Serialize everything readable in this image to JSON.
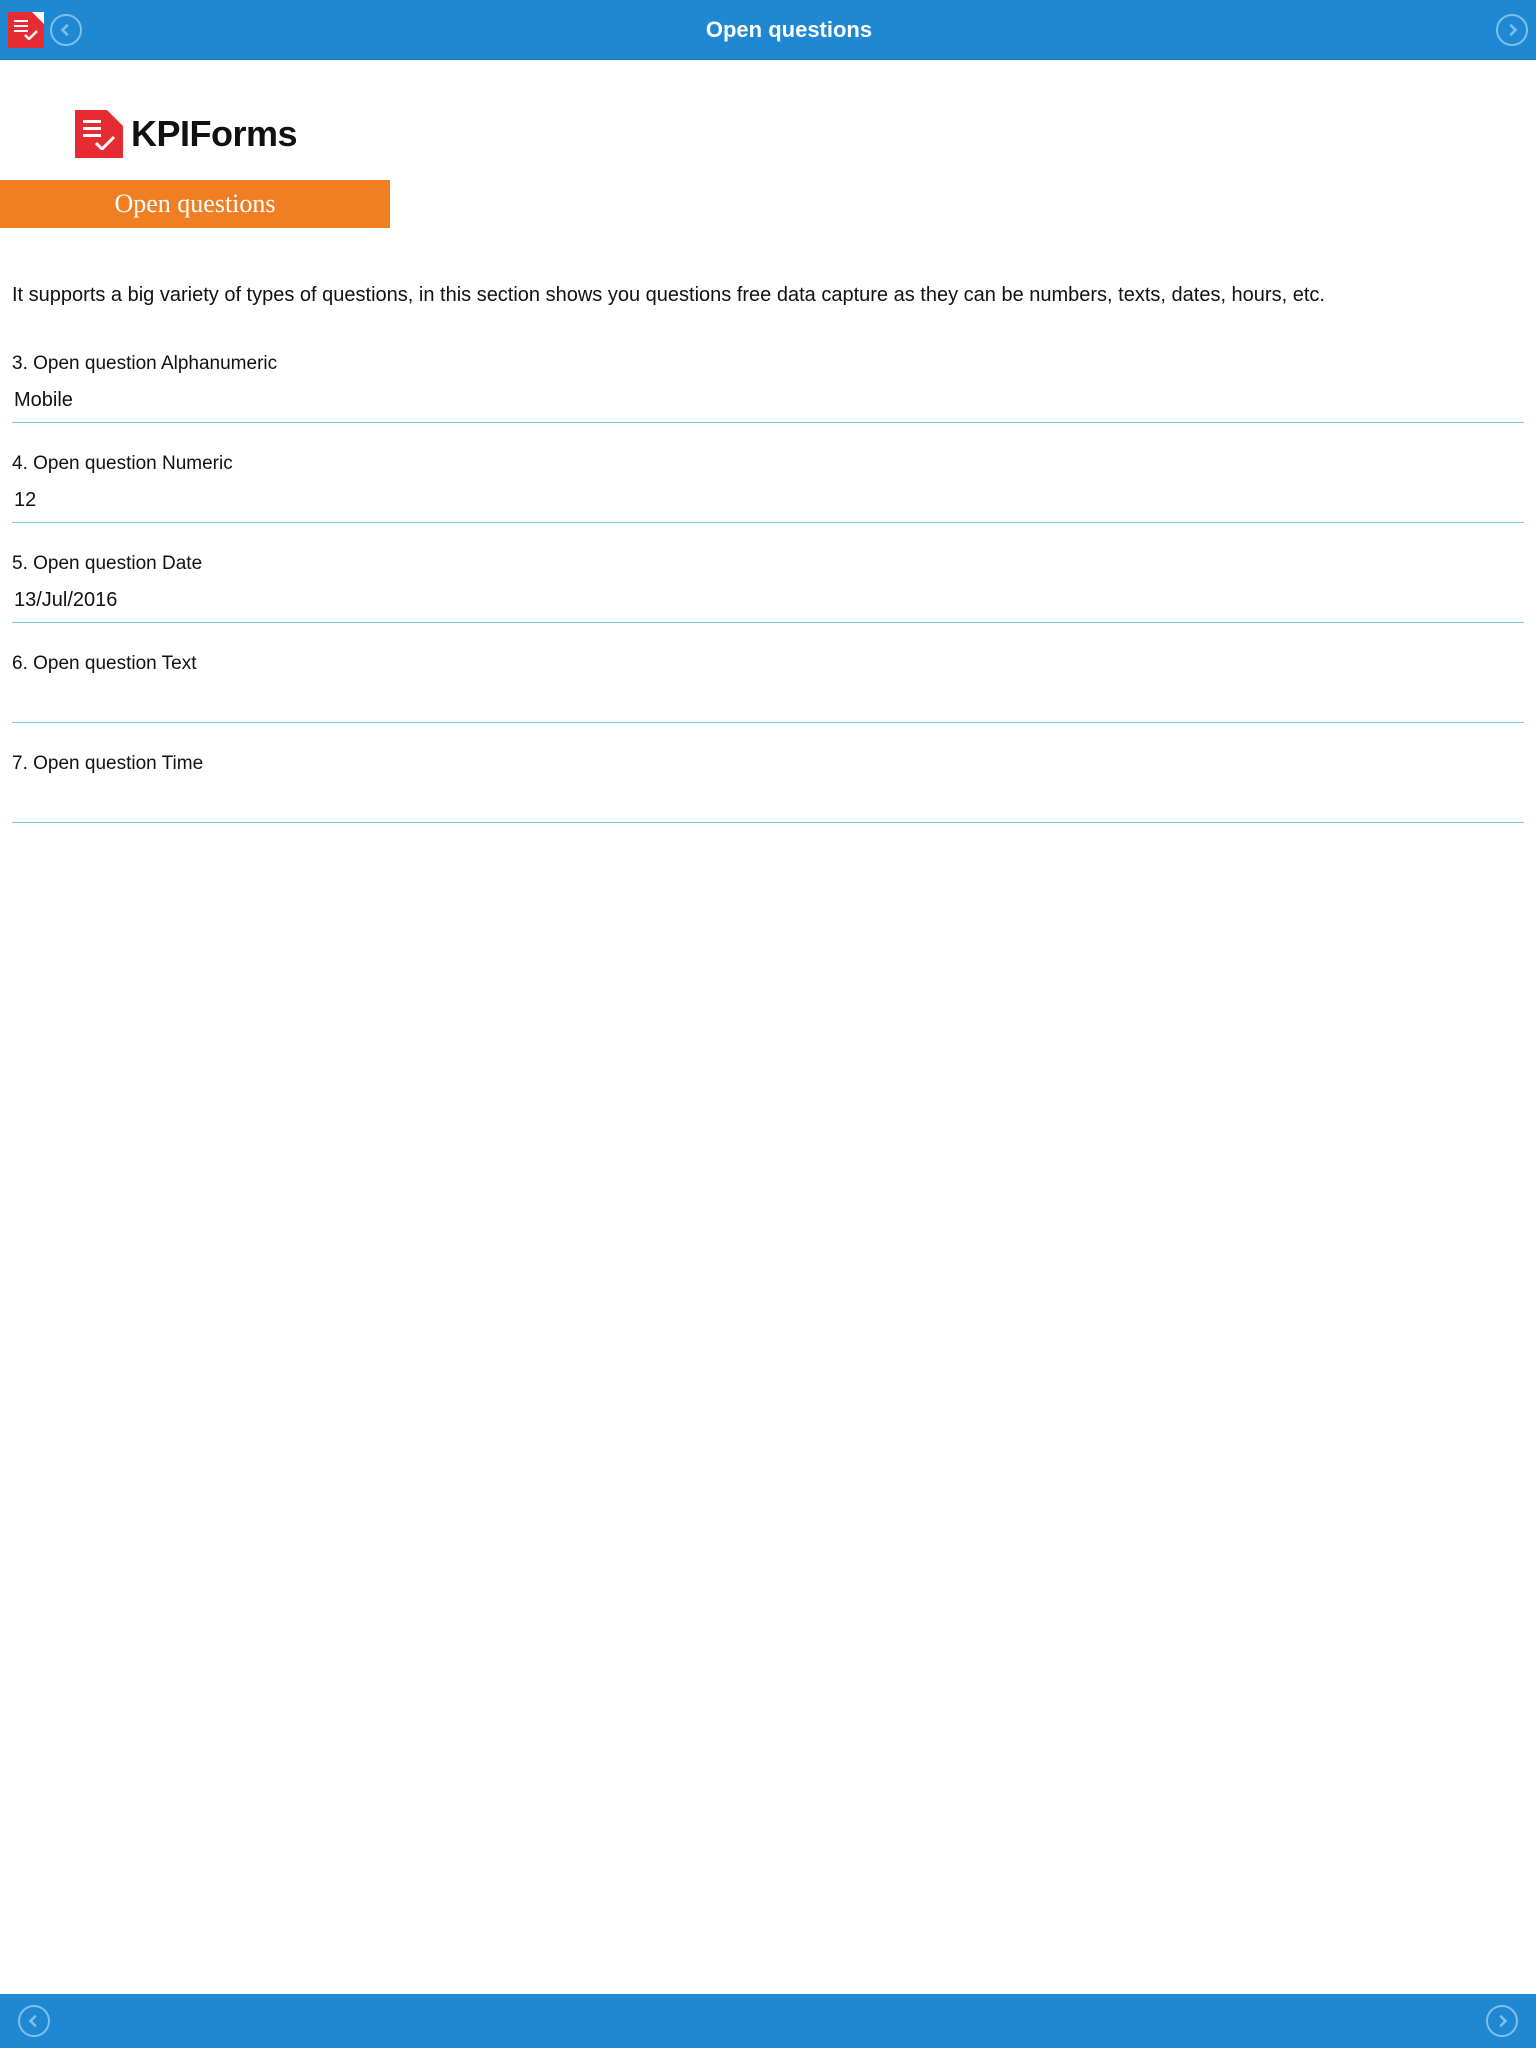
{
  "header": {
    "title": "Open questions"
  },
  "brand": {
    "name": "KPIForms"
  },
  "section": {
    "banner": "Open questions",
    "description": "It supports a big variety of types of questions, in this section shows you questions free data capture as they can be numbers, texts, dates, hours, etc."
  },
  "questions": [
    {
      "label": "3. Open question Alphanumeric",
      "value": "Mobile"
    },
    {
      "label": "4. Open question Numeric",
      "value": "12"
    },
    {
      "label": "5. Open question Date",
      "value": "13/Jul/2016"
    },
    {
      "label": "6. Open question Text",
      "value": ""
    },
    {
      "label": "7. Open question Time",
      "value": ""
    }
  ]
}
